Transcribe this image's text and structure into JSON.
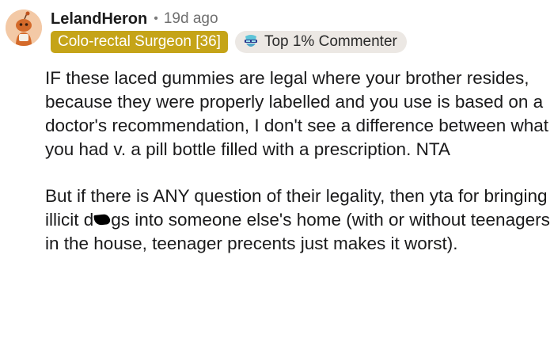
{
  "comment": {
    "author": "LelandHeron",
    "separator": "•",
    "age": "19d ago",
    "user_flair": "Colo-rectal Surgeon [36]",
    "badge": {
      "label": "Top 1% Commenter",
      "icon": "top-commenter-icon"
    },
    "avatar": {
      "icon": "reddit-snoo-avatar",
      "color": "#f3c9a6"
    },
    "paragraphs": [
      "IF these laced gummies are legal where your brother resides, because they were properly labelled and you use is based on a doctor's recommendation, I don't see a difference between what you had v. a pill bottle filled with a prescription. NTA"
    ],
    "paragraph2": {
      "before_redaction": "But if there is ANY question of their legality, then yta for bringing illicit d",
      "after_redaction": "gs into someone else's home (with or without teenagers in the house, teenager precents just makes it worst)."
    }
  },
  "colors": {
    "flair_background": "#c5a418",
    "flair_text": "#ffffff",
    "badge_background": "#ece8e4",
    "text": "#1a1a1b",
    "muted": "#6f6f6f"
  }
}
